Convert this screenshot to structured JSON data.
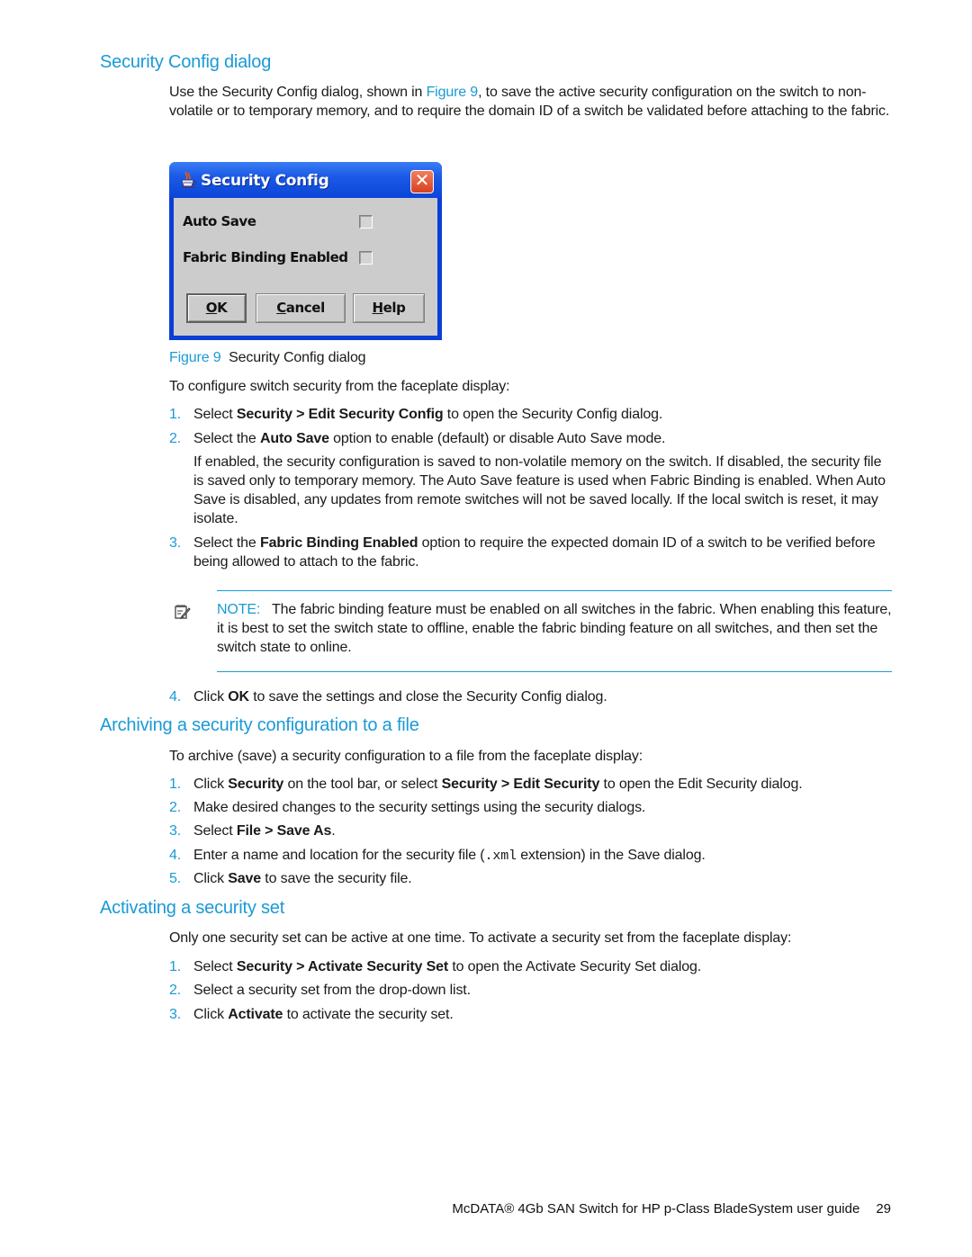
{
  "section1": {
    "heading": "Security Config dialog",
    "intro_before_link": "Use the Security Config dialog, shown in ",
    "intro_link": "Figure 9",
    "intro_after_link": ", to save the active security configuration on the switch to non-volatile or to temporary memory, and to require the domain ID of a switch be validated before attaching to the fabric.",
    "dialog": {
      "title": "Security Config",
      "close_label": "✕",
      "options": [
        {
          "label": "Auto Save",
          "checked": false
        },
        {
          "label": "Fabric Binding Enabled",
          "checked": false
        }
      ],
      "buttons": [
        {
          "mnemonic": "O",
          "rest": "K",
          "label": "OK"
        },
        {
          "mnemonic": "C",
          "rest": "ancel",
          "label": "Cancel"
        },
        {
          "mnemonic": "H",
          "rest": "elp",
          "label": "Help"
        }
      ]
    },
    "figure_caption_label": "Figure 9",
    "figure_caption_text": "Security Config dialog",
    "lead": "To configure switch security from the faceplate display:",
    "steps": [
      {
        "num": "1.",
        "pre": "Select ",
        "bold": "Security > Edit Security Config",
        "post": " to open the Security Config dialog."
      },
      {
        "num": "2.",
        "pre": "Select the ",
        "bold": "Auto Save",
        "post": " option to enable (default) or disable Auto Save mode."
      },
      {
        "num": "3.",
        "pre": "Select the ",
        "bold": "Fabric Binding Enabled",
        "post": " option to require the expected domain ID of a switch to be verified before being allowed to attach to the fabric."
      },
      {
        "num": "4.",
        "pre": "Click ",
        "bold": "OK",
        "post": " to save the settings and close the Security Config dialog."
      }
    ],
    "step2_detail": "If enabled, the security configuration is saved to non-volatile memory on the switch. If disabled, the security file is saved only to temporary memory. The Auto Save feature is used when Fabric Binding is enabled. When Auto Save is disabled, any updates from remote switches will not be saved locally. If the local switch is reset, it may isolate.",
    "note_label": "NOTE:",
    "note_text": "The fabric binding feature must be enabled on all switches in the fabric. When enabling this feature, it is best to set the switch state to offline, enable the fabric binding feature on all switches, and then set the switch state to online."
  },
  "section2": {
    "heading": "Archiving a security configuration to a file",
    "lead": "To archive (save) a security configuration to a file from the faceplate display:",
    "steps": [
      {
        "num": "1.",
        "pre": "Click ",
        "bold": "Security",
        "mid": " on the tool bar, or select ",
        "bold2": "Security > Edit Security",
        "post": " to open the Edit Security dialog."
      },
      {
        "num": "2.",
        "pre": "Make desired changes to the security settings using the security dialogs.",
        "bold": "",
        "post": ""
      },
      {
        "num": "3.",
        "pre": "Select ",
        "bold": "File > Save As",
        "post": "."
      },
      {
        "num": "4.",
        "pre": "Enter a name and location for the security file (",
        "code": ".xml",
        "post": " extension) in the Save dialog."
      },
      {
        "num": "5.",
        "pre": "Click ",
        "bold": "Save",
        "post": " to save the security file."
      }
    ]
  },
  "section3": {
    "heading": "Activating a security set",
    "lead": "Only one security set can be active at one time. To activate a security set from the faceplate display:",
    "steps": [
      {
        "num": "1.",
        "pre": "Select ",
        "bold": "Security > Activate Security Set",
        "post": " to open the Activate Security Set dialog."
      },
      {
        "num": "2.",
        "pre": "Select a security set from the drop-down list.",
        "bold": "",
        "post": ""
      },
      {
        "num": "3.",
        "pre": "Click ",
        "bold": "Activate",
        "post": " to activate the security set."
      }
    ]
  },
  "footer": {
    "title": "McDATA® 4Gb SAN Switch for HP p-Class BladeSystem user guide",
    "page_number": "29"
  },
  "colors": {
    "accent": "#1a9ad6",
    "dialog_title_bar": "#1b5ae6",
    "dialog_body": "#cccccc",
    "close_button": "#d8401e"
  }
}
